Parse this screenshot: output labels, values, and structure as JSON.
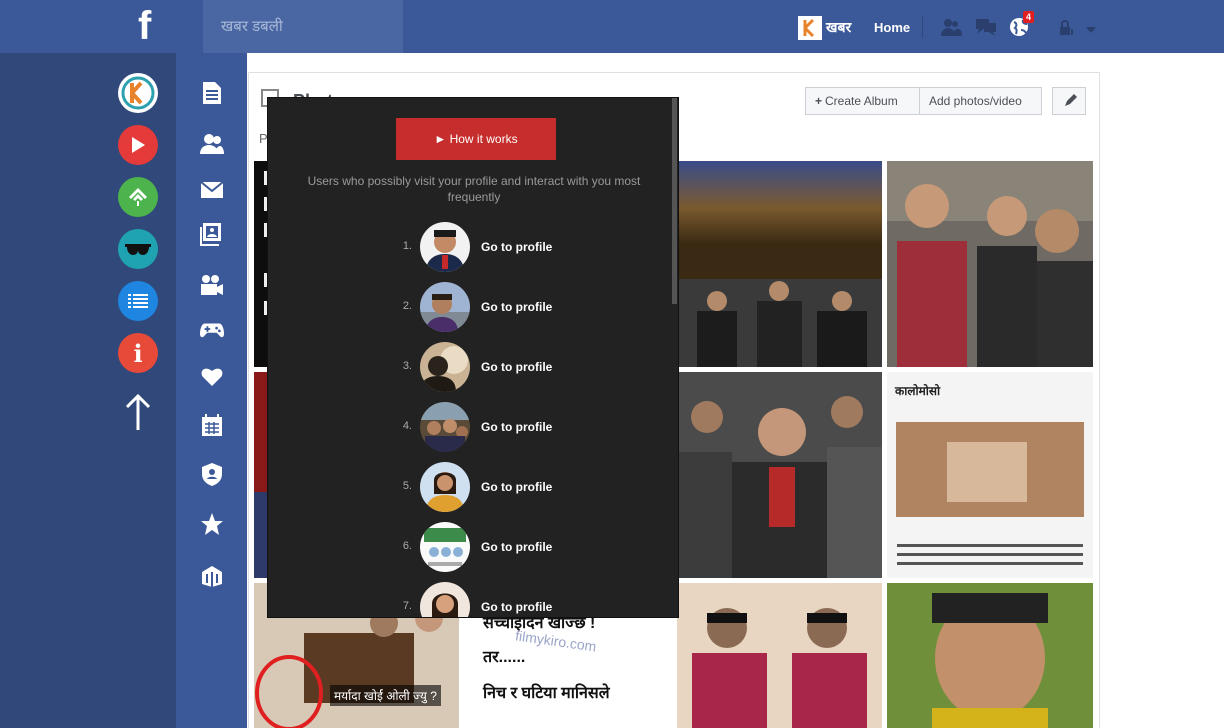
{
  "topbar": {
    "search_placeholder": "खबर डबली",
    "khabar_label": "खबर",
    "home_label": "Home",
    "notification_count": "4"
  },
  "left_apps": [
    {
      "name": "kk-app",
      "glyph": "K",
      "color": "#ffffff"
    },
    {
      "name": "youtube-app",
      "glyph": "▶",
      "color": "#e53a3a"
    },
    {
      "name": "feedly-app",
      "glyph": "f",
      "color": "#4db34d"
    },
    {
      "name": "glasses-app",
      "glyph": "◡◡",
      "color": "#1fa3b3"
    },
    {
      "name": "list-app",
      "glyph": "≡",
      "color": "#1e86e0"
    },
    {
      "name": "info-app",
      "glyph": "i",
      "color": "#e84a3a"
    }
  ],
  "content": {
    "create_album_label": "Create Album",
    "add_photos_label": "Add photos/video",
    "section_title": "Photos",
    "section_sub": "P"
  },
  "popup": {
    "how_label": "► How it works",
    "description": "Users who possibly visit your profile and interact with you most frequently",
    "profiles": [
      {
        "num": "1.",
        "link": "Go to profile"
      },
      {
        "num": "2.",
        "link": "Go to profile"
      },
      {
        "num": "3.",
        "link": "Go to profile"
      },
      {
        "num": "4.",
        "link": "Go to profile"
      },
      {
        "num": "5.",
        "link": "Go to profile"
      },
      {
        "num": "6.",
        "link": "Go to profile"
      },
      {
        "num": "7.",
        "link": "Go to profile"
      }
    ]
  },
  "photos": {
    "p_bottomleft_caption": "मर्यादा खोर्ई ओली ज्यु ?",
    "p_bottom2_line1": "सच्चाईदिन खोज्छ !",
    "p_bottom2_line2": "तर......",
    "p_bottom2_line3": "निच र घटिया मानिसले",
    "p_bottom2_watermark": "filmykiro.com",
    "p_article_title": "कालोमोसो",
    "p_article_body": "लोकमानसिंह कार्कीलाई सर्वोच्च अदालत भित्रै कालोमोसो दलिएको छ । बिहीबार बयानको लागि अदालत आएका कार्कीलाई पैसी"
  }
}
